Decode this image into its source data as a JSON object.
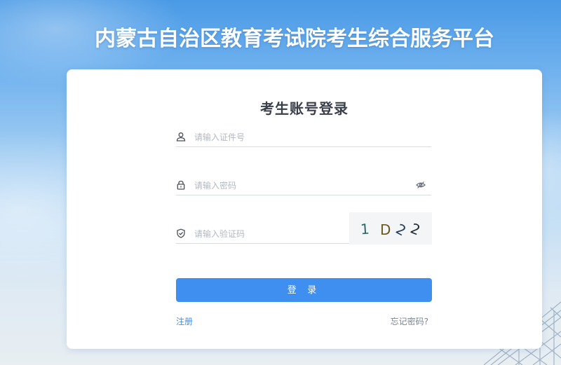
{
  "header": {
    "title": "内蒙古自治区教育考试院考生综合服务平台"
  },
  "login": {
    "title": "考生账号登录",
    "id_placeholder": "请输入证件号",
    "password_placeholder": "请输入密码",
    "captcha_placeholder": "请输入验证码",
    "captcha_chars": [
      "1",
      "D",
      "2",
      "2"
    ],
    "submit_label": "登 录",
    "register_link": "注册",
    "forgot_link": "忘记密码?"
  },
  "colors": {
    "primary": "#3e8ff0",
    "title_text": "#ffffff",
    "placeholder": "#b3b8c0"
  },
  "icons": {
    "id_field": "user-icon",
    "password_field": "lock-icon",
    "password_toggle": "eye-hidden-icon",
    "captcha_field": "shield-icon"
  }
}
